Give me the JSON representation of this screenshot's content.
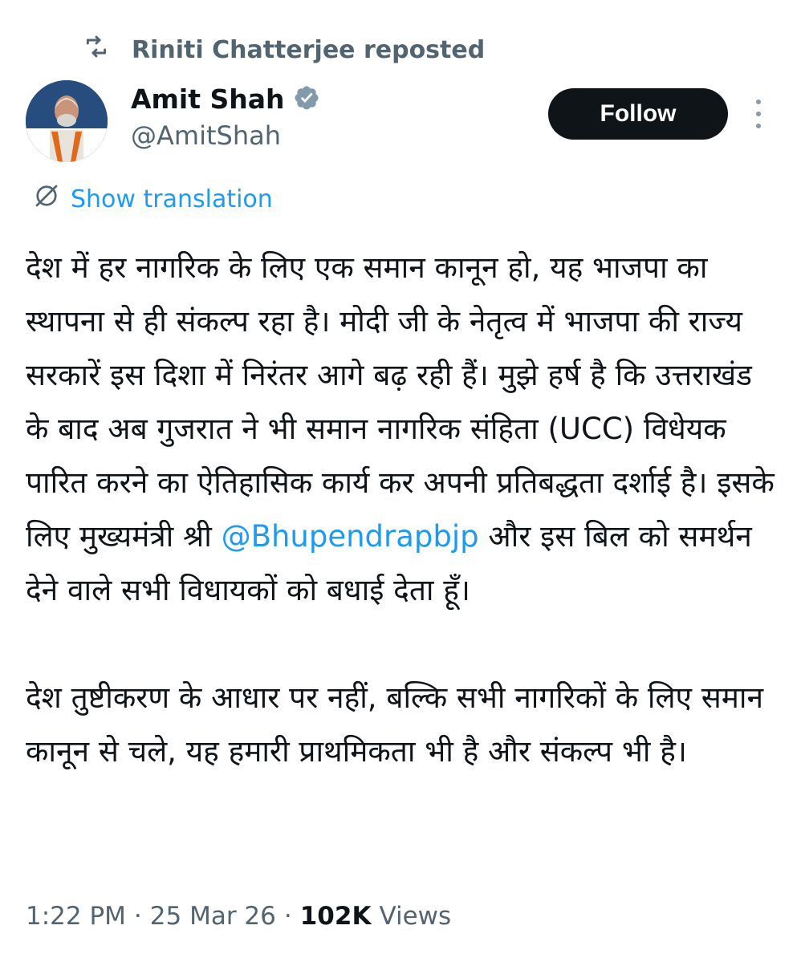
{
  "repost": {
    "label": "Riniti Chatterjee reposted",
    "icon": "repost-icon"
  },
  "author": {
    "name": "Amit Shah",
    "handle": "@AmitShah",
    "verified": true,
    "verified_icon": "verified-badge-icon"
  },
  "follow_label": "Follow",
  "more_icon": "more-vertical-icon",
  "translation": {
    "label": "Show translation",
    "icon": "translate-icon"
  },
  "tweet": {
    "para1_before": "देश में हर नागरिक के लिए एक समान कानून हो, यह भाजपा का स्थापना से ही संकल्प रहा है। मोदी जी के नेतृत्व में भाजपा की राज्य सरकारें इस दिशा में निरंतर आगे बढ़ रही हैं। मुझे हर्ष है कि उत्तराखंड के बाद अब गुजरात ने भी समान नागरिक संहिता (UCC) विधेयक पारित करने का ऐतिहासिक कार्य कर अपनी प्रतिबद्धता दर्शाई है। इसके लिए मुख्यमंत्री श्री ",
    "mention": "@Bhupendrapbjp",
    "para1_after": " और इस बिल को समर्थन देने वाले सभी विधायकों को बधाई देता हूँ।",
    "para2": "देश तुष्टीकरण के आधार पर नहीं, बल्कि सभी नागरिकों के लिए समान कानून से चले, यह हमारी प्राथमिकता भी है और संकल्प भी है।"
  },
  "meta": {
    "time": "1:22 PM",
    "separator": "·",
    "date": "25 Mar 26",
    "views_count": "102K",
    "views_label": "Views"
  },
  "colors": {
    "text": "#0f1419",
    "secondary": "#536471",
    "link": "#1d9bf0",
    "verified": "#829aab",
    "follow_bg": "#0f1419"
  }
}
